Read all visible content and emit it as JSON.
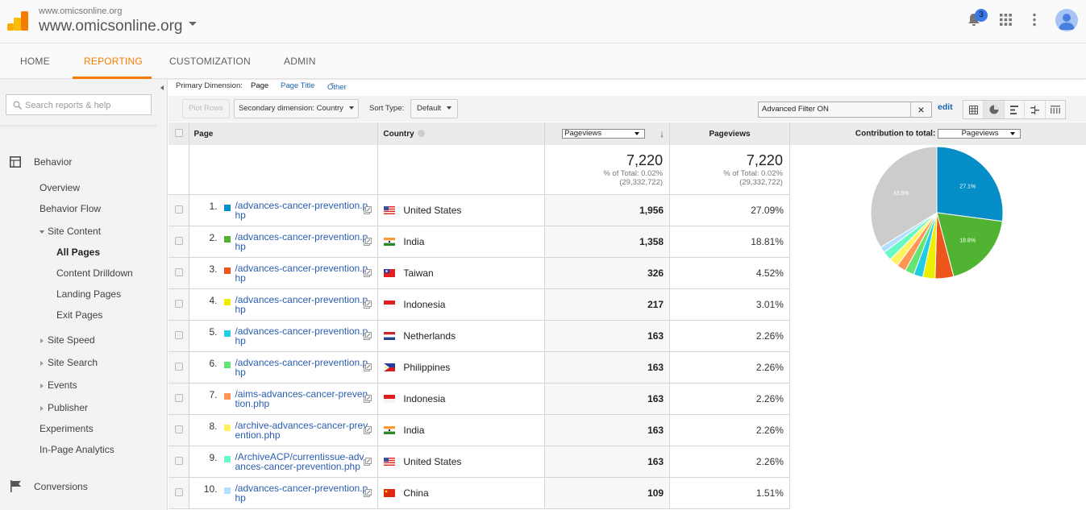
{
  "account": {
    "small_name": "www.omicsonline.org",
    "property_name": "www.omicsonline.org"
  },
  "header": {
    "notification_count": "3"
  },
  "nav": {
    "tabs": [
      "HOME",
      "REPORTING",
      "CUSTOMIZATION",
      "ADMIN"
    ],
    "active": "REPORTING"
  },
  "sidebar": {
    "search_placeholder": "Search reports & help",
    "section_behavior": "Behavior",
    "items": {
      "overview": "Overview",
      "behavior_flow": "Behavior Flow",
      "site_content": "Site Content",
      "all_pages": "All Pages",
      "content_drilldown": "Content Drilldown",
      "landing_pages": "Landing Pages",
      "exit_pages": "Exit Pages",
      "site_speed": "Site Speed",
      "site_search": "Site Search",
      "events": "Events",
      "publisher": "Publisher",
      "experiments": "Experiments",
      "in_page_analytics": "In-Page Analytics"
    },
    "section_conversions": "Conversions"
  },
  "dimensions": {
    "label": "Primary Dimension:",
    "current": "Page",
    "page_title": "Page Title",
    "other": "Other"
  },
  "toolbar": {
    "plot_rows": "Plot Rows",
    "secondary_dimension": "Secondary dimension: Country",
    "sort_type_label": "Sort Type:",
    "sort_type_value": "Default",
    "filter_text": "Advanced Filter ON",
    "filter_clear": "×",
    "edit": "edit"
  },
  "table": {
    "headers": {
      "page": "Page",
      "country": "Country",
      "metric_select": "Pageviews",
      "pageviews": "Pageviews",
      "contribution_label": "Contribution to total:",
      "contribution_select": "Pageviews"
    },
    "summary": {
      "value": "7,220",
      "pct_of_total": "% of Total: 0.02%",
      "total": "(29,332,722)",
      "value2": "7,220",
      "pct_of_total2": "% of Total: 0.02%",
      "total2": "(29,332,722)"
    },
    "rows": [
      {
        "rank": "1.",
        "color": "#058dc7",
        "page": "/advances-cancer-prevention.php",
        "country": "United States",
        "flag": "us",
        "pageviews": "1,956",
        "pct": "27.09%"
      },
      {
        "rank": "2.",
        "color": "#50b432",
        "page": "/advances-cancer-prevention.php",
        "country": "India",
        "flag": "in",
        "pageviews": "1,358",
        "pct": "18.81%"
      },
      {
        "rank": "3.",
        "color": "#ed561b",
        "page": "/advances-cancer-prevention.php",
        "country": "Taiwan",
        "flag": "tw",
        "pageviews": "326",
        "pct": "4.52%"
      },
      {
        "rank": "4.",
        "color": "#edef00",
        "page": "/advances-cancer-prevention.php",
        "country": "Indonesia",
        "flag": "id",
        "pageviews": "217",
        "pct": "3.01%"
      },
      {
        "rank": "5.",
        "color": "#24cbe5",
        "page": "/advances-cancer-prevention.php",
        "country": "Netherlands",
        "flag": "nl",
        "pageviews": "163",
        "pct": "2.26%"
      },
      {
        "rank": "6.",
        "color": "#64e572",
        "page": "/advances-cancer-prevention.php",
        "country": "Philippines",
        "flag": "ph",
        "pageviews": "163",
        "pct": "2.26%"
      },
      {
        "rank": "7.",
        "color": "#ff9655",
        "page": "/aims-advances-cancer-prevention.php",
        "country": "Indonesia",
        "flag": "id",
        "pageviews": "163",
        "pct": "2.26%"
      },
      {
        "rank": "8.",
        "color": "#fff263",
        "page": "/archive-advances-cancer-prevention.php",
        "country": "India",
        "flag": "in",
        "pageviews": "163",
        "pct": "2.26%"
      },
      {
        "rank": "9.",
        "color": "#6af9c4",
        "page": "/ArchiveACP/currentissue-advances-cancer-prevention.php",
        "country": "United States",
        "flag": "us",
        "pageviews": "163",
        "pct": "2.26%"
      },
      {
        "rank": "10.",
        "color": "#b2deff",
        "page": "/advances-cancer-prevention.php",
        "country": "China",
        "flag": "cn",
        "pageviews": "109",
        "pct": "1.51%"
      }
    ]
  },
  "chart_data": {
    "type": "pie",
    "title": "Contribution to total: Pageviews",
    "categories": [
      "1",
      "2",
      "3",
      "4",
      "5",
      "6",
      "7",
      "8",
      "9",
      "10",
      "Other"
    ],
    "values": [
      27.09,
      18.81,
      4.52,
      3.01,
      2.26,
      2.26,
      2.26,
      2.26,
      2.26,
      1.51,
      33.76
    ],
    "colors": [
      "#058dc7",
      "#50b432",
      "#ed561b",
      "#edef00",
      "#24cbe5",
      "#64e572",
      "#ff9655",
      "#fff263",
      "#6af9c4",
      "#b2deff",
      "#cccccc"
    ],
    "data_labels": [
      "27.1%",
      "18.8%",
      "",
      "",
      "",
      "",
      "",
      "",
      "",
      "",
      "33.8%"
    ]
  }
}
